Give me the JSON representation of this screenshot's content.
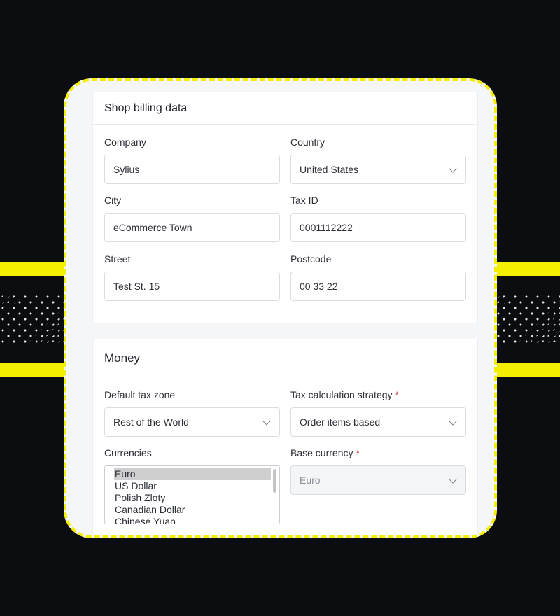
{
  "billing": {
    "title": "Shop billing data",
    "company_label": "Company",
    "company_value": "Sylius",
    "country_label": "Country",
    "country_value": "United States",
    "city_label": "City",
    "city_value": "eCommerce Town",
    "taxid_label": "Tax ID",
    "taxid_value": "0001112222",
    "street_label": "Street",
    "street_value": "Test St. 15",
    "postcode_label": "Postcode",
    "postcode_value": "00 33 22"
  },
  "money": {
    "title": "Money",
    "tax_zone_label": "Default tax zone",
    "tax_zone_value": "Rest of the World",
    "tax_strategy_label": "Tax calculation strategy",
    "tax_strategy_value": "Order items based",
    "required_mark": "*",
    "currencies_label": "Currencies",
    "currencies": [
      "Euro",
      "US Dollar",
      "Polish Zloty",
      "Canadian Dollar",
      "Chinese Yuan"
    ],
    "selected_currency": "Euro",
    "base_currency_label": "Base currency",
    "base_currency_value": "Euro"
  },
  "colors": {
    "accent": "#f4ee00",
    "background": "#0c0d10",
    "required": "#d0312d"
  }
}
